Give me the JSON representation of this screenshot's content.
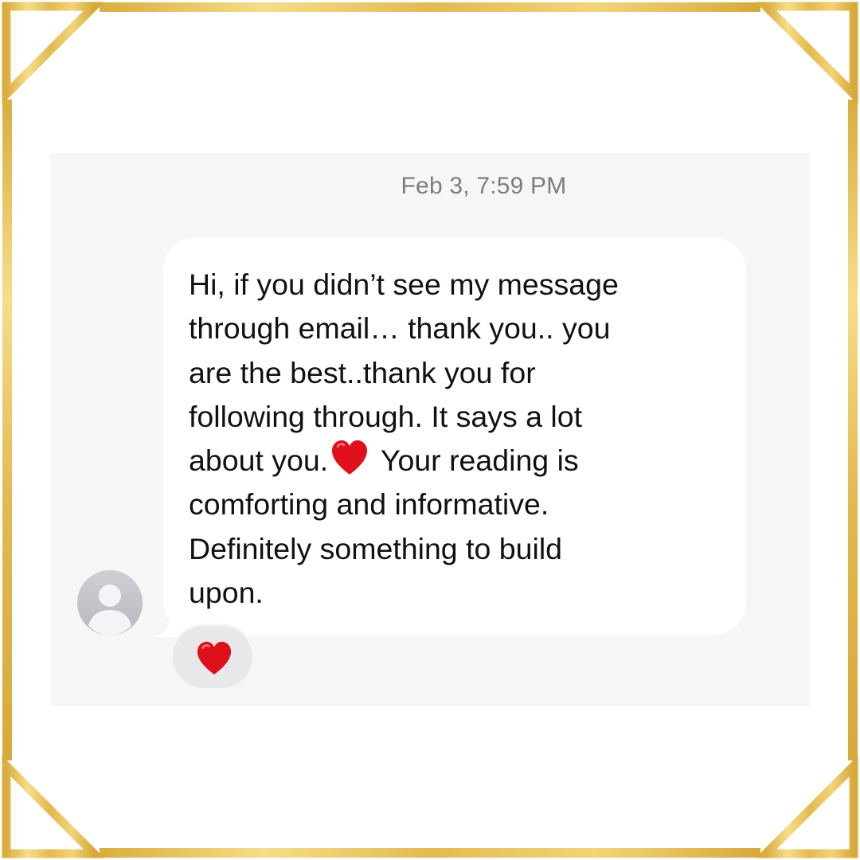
{
  "conversation": {
    "timestamp": "Feb 3, 7:59 PM",
    "message_part1": "Hi, if you didn’t see my message\nthrough email… thank you.. you\nare the best..thank you for\nfollowing through. It says a lot\nabout you.",
    "message_part2": " Your reading is\ncomforting and informative.\nDefinitely something to build\nupon.",
    "inline_icon": "red-heart-icon",
    "reaction_icon": "red-heart-icon",
    "avatar_icon": "person-icon"
  },
  "colors": {
    "frame_gold": "#e8c15a",
    "background_gray": "#f6f6f6",
    "bubble": "#ffffff",
    "reaction_pill": "#e8e8ea",
    "heart_red": "#e0101a"
  }
}
